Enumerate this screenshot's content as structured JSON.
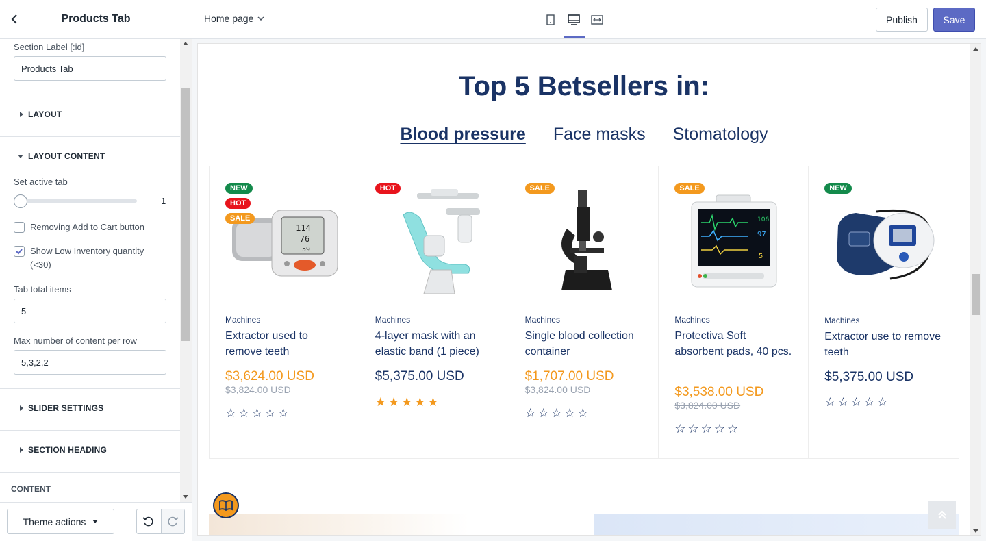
{
  "sidebar": {
    "title": "Products Tab",
    "section_label_field": {
      "label": "Section Label [:id]",
      "value": "Products Tab"
    },
    "sections": {
      "layout": "LAYOUT",
      "layout_content": "LAYOUT CONTENT",
      "slider_settings": "SLIDER SETTINGS",
      "section_heading": "SECTION HEADING",
      "content": "CONTENT"
    },
    "active_tab": {
      "label": "Set active tab",
      "value": "1"
    },
    "remove_cart": {
      "label": "Removing Add to Cart button",
      "checked": false
    },
    "low_inventory": {
      "label_line1": "Show Low Inventory quantity",
      "label_line2": "(<30)",
      "checked": true
    },
    "tab_total": {
      "label": "Tab total items",
      "value": "5"
    },
    "max_per_row": {
      "label": "Max number of content per row",
      "value": "5,3,2,2"
    },
    "footer": {
      "theme_actions": "Theme actions"
    }
  },
  "topbar": {
    "page": "Home page",
    "publish": "Publish",
    "save": "Save"
  },
  "preview": {
    "heading": "Top 5 Betsellers in:",
    "tabs": [
      "Blood pressure",
      "Face masks",
      "Stomatology"
    ],
    "active_tab_index": 0,
    "products": [
      {
        "badges": [
          "NEW",
          "HOT",
          "SALE"
        ],
        "vendor": "Machines",
        "name": "Extractor used to remove teeth",
        "price": "$3,624.00 USD",
        "old_price": "$3,824.00 USD",
        "rating": 0,
        "image": "blood-pressure-monitor"
      },
      {
        "badges": [
          "HOT"
        ],
        "vendor": "Machines",
        "name": "4-layer mask with an elastic band (1 piece)",
        "price": "$5,375.00 USD",
        "old_price": "",
        "rating": 5,
        "image": "dental-chair"
      },
      {
        "badges": [
          "SALE"
        ],
        "vendor": "Machines",
        "name": "Single blood collection container",
        "price": "$1,707.00 USD",
        "old_price": "$3,824.00 USD",
        "rating": 0,
        "image": "microscope"
      },
      {
        "badges": [
          "SALE"
        ],
        "vendor": "Machines",
        "name": "Protectiva Soft absorbent pads, 40 pcs.",
        "price": "$3,538.00 USD",
        "old_price": "$3,824.00 USD",
        "rating": 0,
        "image": "patient-monitor"
      },
      {
        "badges": [
          "NEW"
        ],
        "vendor": "Machines",
        "name": "Extractor use to remove teeth",
        "price": "$5,375.00 USD",
        "old_price": "",
        "rating": 0,
        "image": "bp-cuff-monitor"
      }
    ]
  },
  "colors": {
    "accent": "#5c6ac4",
    "navy": "#1a3365",
    "orange": "#f3991e",
    "new_badge": "#138a4b",
    "hot_badge": "#e8141c"
  }
}
